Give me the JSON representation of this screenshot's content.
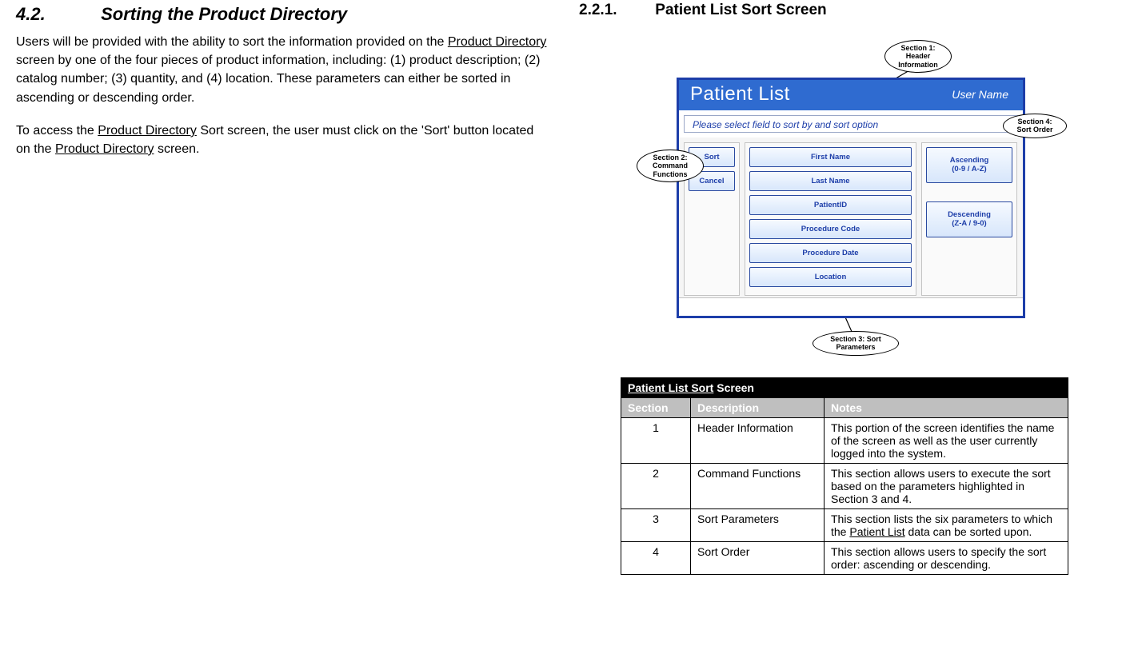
{
  "left": {
    "heading_num": "4.2.",
    "heading_text": "Sorting the Product Directory",
    "para1_a": "Users will be provided with the ability to sort the information provided on the ",
    "para1_u1": "Product Directory",
    "para1_b": " screen by one of the four pieces of product information, including: (1) product description; (2) catalog number; (3) quantity, and (4) location.  These parameters can either be sorted in ascending or descending order.",
    "para2_a": "To access the ",
    "para2_u1": "Product Directory",
    "para2_b": " Sort screen, the user must click on the 'Sort' button located on the ",
    "para2_u2": "Product Directory",
    "para2_c": " screen."
  },
  "right": {
    "heading_num": "2.2.1.",
    "heading_text": "Patient List Sort Screen",
    "window": {
      "title": "Patient List",
      "user": "User Name",
      "instruction": "Please select field to sort by and sort option",
      "cmd": {
        "sort": "Sort",
        "cancel": "Cancel"
      },
      "params": [
        "First Name",
        "Last Name",
        "PatientID",
        "Procedure Code",
        "Procedure Date",
        "Location"
      ],
      "order": {
        "asc_line1": "Ascending",
        "asc_line2": "(0-9 / A-Z)",
        "desc_line1": "Descending",
        "desc_line2": "(Z-A / 9-0)"
      }
    },
    "callouts": {
      "c1": "Section 1:\nHeader Information",
      "c2": "Section 2:\nCommand Functions",
      "c3": "Section 3:\nSort Parameters",
      "c4": "Section 4:\nSort Order"
    },
    "table_title_u": "Patient List Sort",
    "table_title_rest": " Screen",
    "table_headers": {
      "sec": "Section",
      "desc": "Description",
      "notes": "Notes"
    },
    "rows": [
      {
        "sec": "1",
        "desc": "Header Information",
        "note": "This portion of the screen identifies the name of the screen as well as the user currently logged into the system."
      },
      {
        "sec": "2",
        "desc": "Command Functions",
        "note": "This section allows users to execute the sort based on the parameters highlighted in Section 3 and 4."
      },
      {
        "sec": "3",
        "desc": "Sort Parameters",
        "note_a": "This section lists the six parameters to which the ",
        "note_u": "Patient List",
        "note_b": " data can be sorted upon."
      },
      {
        "sec": "4",
        "desc": "Sort Order",
        "note": "This section allows users to specify the sort order: ascending or descending."
      }
    ]
  }
}
